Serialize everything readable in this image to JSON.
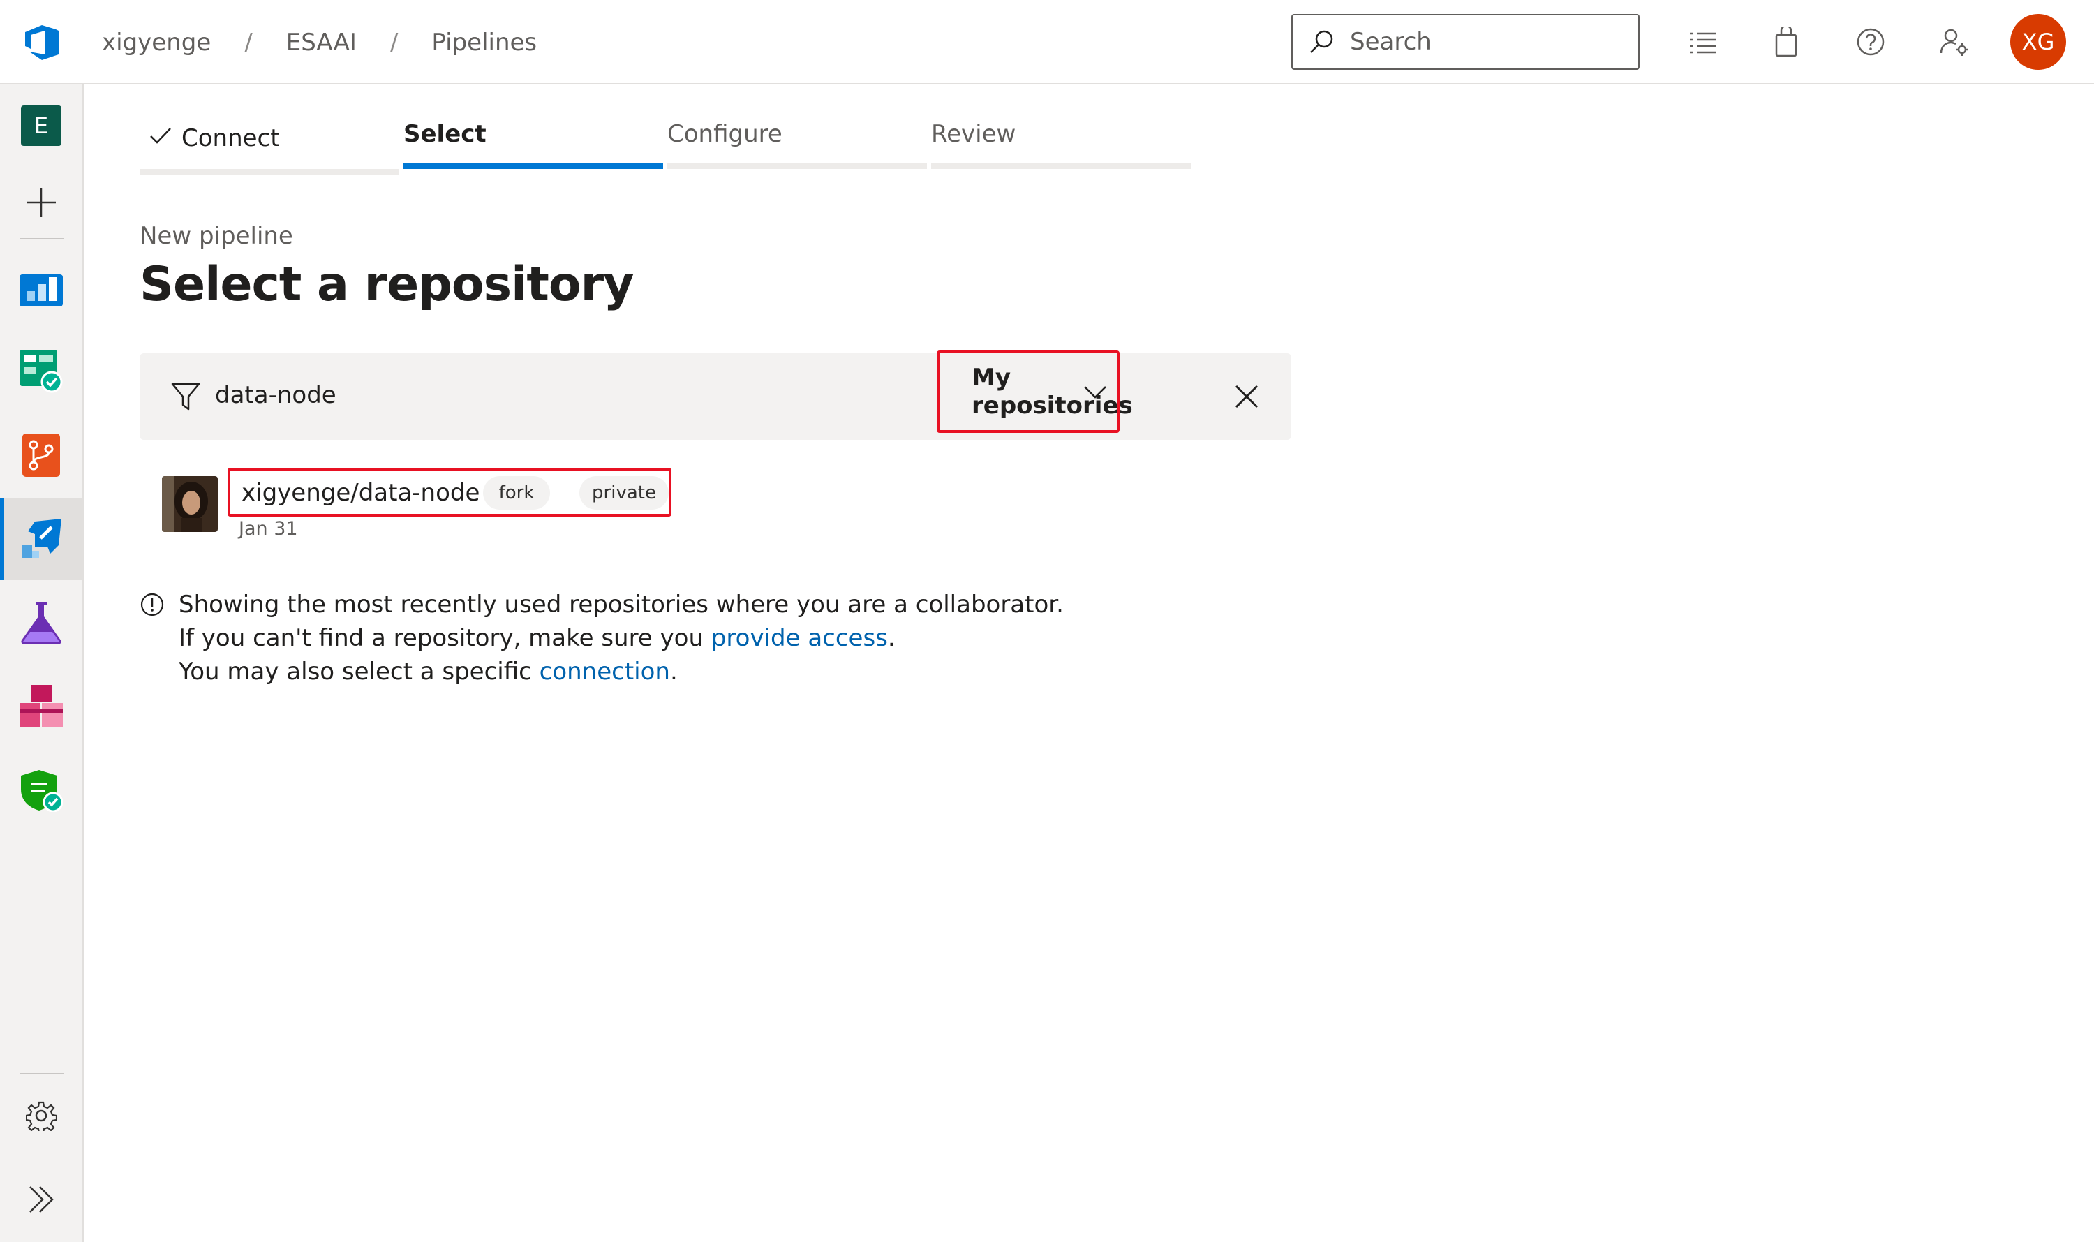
{
  "breadcrumb": {
    "org": "xigyenge",
    "project": "ESAAI",
    "page": "Pipelines",
    "separator": "/"
  },
  "search": {
    "placeholder": "Search"
  },
  "user": {
    "initials": "XG",
    "avatar_color": "#d83b01"
  },
  "sidebar": {
    "project_initial": "E",
    "items": [
      {
        "name": "Project",
        "icon": "project-badge-icon"
      },
      {
        "name": "New",
        "icon": "plus-icon"
      },
      {
        "name": "Overview",
        "icon": "overview-icon"
      },
      {
        "name": "Boards",
        "icon": "boards-icon"
      },
      {
        "name": "Repos",
        "icon": "repos-icon"
      },
      {
        "name": "Pipelines",
        "icon": "pipelines-icon",
        "active": true
      },
      {
        "name": "Test Plans",
        "icon": "test-plans-icon"
      },
      {
        "name": "Artifacts",
        "icon": "artifacts-icon"
      },
      {
        "name": "Security",
        "icon": "security-icon"
      },
      {
        "name": "Project settings",
        "icon": "gear-icon"
      },
      {
        "name": "Expand",
        "icon": "double-chevron-icon"
      }
    ]
  },
  "wizard": {
    "steps": [
      {
        "label": "Connect",
        "state": "done"
      },
      {
        "label": "Select",
        "state": "current"
      },
      {
        "label": "Configure",
        "state": "upcoming"
      },
      {
        "label": "Review",
        "state": "upcoming"
      }
    ]
  },
  "page": {
    "subtitle": "New pipeline",
    "title": "Select a repository"
  },
  "filter": {
    "value": "data-node",
    "scope": "My repositories"
  },
  "repositories": [
    {
      "name": "xigyenge/data-node",
      "tags": [
        "fork",
        "private"
      ],
      "date": "Jan 31"
    }
  ],
  "info": {
    "line1": "Showing the most recently used repositories where you are a collaborator.",
    "line2_prefix": "If you can't find a repository, make sure you ",
    "line2_link": "provide access",
    "line2_suffix": ".",
    "line3_prefix": "You may also select a specific ",
    "line3_link": "connection",
    "line3_suffix": "."
  },
  "colors": {
    "accent": "#0078d4",
    "highlight": "#e81123",
    "link": "#0062ad"
  }
}
